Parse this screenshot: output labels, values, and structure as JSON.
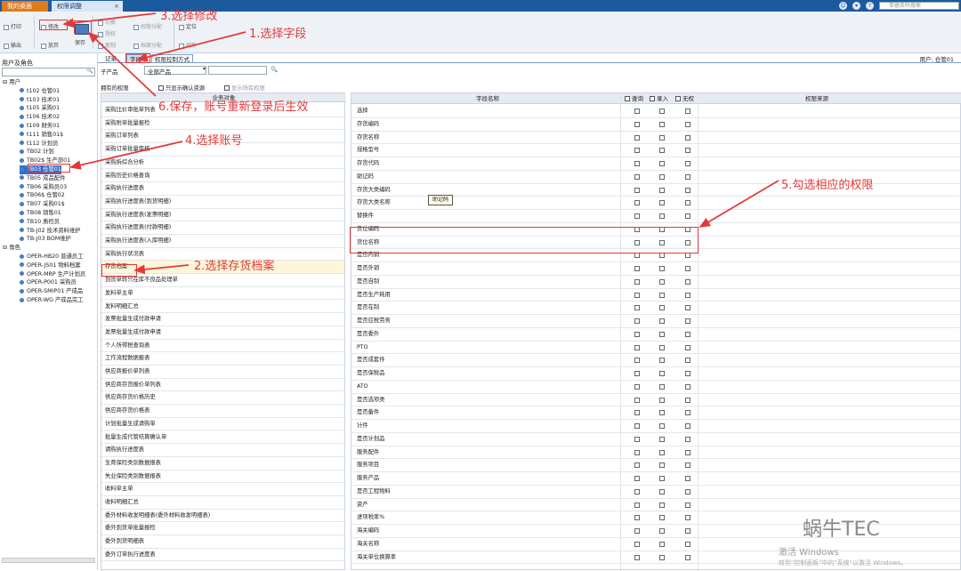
{
  "titlebar": {
    "tab_home": "我的桌面",
    "tab_permission": "权限调整",
    "tab_close": "×",
    "search_placeholder": "单据条码搜索"
  },
  "toolbar": {
    "print": "打印",
    "export": "输出",
    "modify": "修改",
    "abandon": "放弃",
    "save": "保存",
    "copy": "复制",
    "toggle": "切换",
    "authorize": "授权",
    "permission_assign": "权限分配",
    "data_assign": "档案分配",
    "locate": "定位",
    "refresh": "刷新"
  },
  "left_panel": {
    "title": "用户及角色",
    "search_btn": "🔍",
    "users_root": "用户",
    "users": [
      "t102  仓管01",
      "t103  技术01",
      "t105  采购01",
      "t106  技术02",
      "t109  财务01",
      "t111  销售01$",
      "t112  计划员",
      "TB02  计划",
      "TB02$  生产部01",
      "TB03  仓管01",
      "TB05  成品配件",
      "TB06  采购员03",
      "TB06$  仓管02",
      "TB07  采购01$",
      "TB08  销售01",
      "TB10  质检员",
      "TB-J02  技术资料维护",
      "TB-J03  BOM维护"
    ],
    "roles_root": "角色",
    "roles": [
      "OPER-HB20  普通员工",
      "OPER-JS01  物料档案",
      "OPER-MRP  生产计划员",
      "OPER-P001  采购员",
      "OPER-SMIP01  产成品",
      "OPER-WG  产成品完工"
    ]
  },
  "subtabs": {
    "record": "记录",
    "field": "字段",
    "control": "权限控制方式"
  },
  "user_label": "用户: 仓管01",
  "filter": {
    "subproduct_label": "子产品",
    "subproduct_value": "全部产品",
    "owned_label": "拥有的权限",
    "only_show_tail": "只显示确认资源",
    "show_all": "显示所有权限"
  },
  "object_list": {
    "header": "业务对象",
    "rows": [
      "采购比价审批单列表",
      "采购附单批量报检",
      "采购订单列表",
      "采购订单批量审核",
      "采购拆综合分析",
      "采购历史价格查询",
      "采购执行进度表",
      "采购执行进度表(到货明细)",
      "采购执行进度表(发票明细)",
      "采购执行进度表(付款明细)",
      "采购执行进度表(入库明细)",
      "采购执行状况表",
      "存货档案",
      "到货单转只在库不良品处理单",
      "发料单主单",
      "发料明细汇总",
      "发票批量生成付款申请",
      "发票批量生成付款申请",
      "个人所得税查询表",
      "工作流程数据报表",
      "供应商报价单列表",
      "供应商存货报价单列表",
      "供应商存货价格历史",
      "供应商存货价格表",
      "计划批量生成请购单",
      "批量生成代管结算确认单",
      "请购执行进度表",
      "生育保险类别数据报表",
      "失业保险类别数据报表",
      "收料单主单",
      "收料明细汇总",
      "委外材料收发明细表(委外材料收发明细表)",
      "委外到货单批量报检",
      "委外到货明细表",
      "委外订单执行进度表"
    ]
  },
  "field_grid": {
    "header_name": "字段名称",
    "header_query": "查询",
    "header_entry": "录入",
    "header_none": "无权",
    "header_source": "权限来源",
    "rows": [
      "选择",
      "存货编码",
      "存货名称",
      "规格型号",
      "存货代码",
      "助记码",
      "存货大类编码",
      "存货大类名称",
      "替换件",
      "货位编码",
      "货位名称",
      "是否内销",
      "是否外销",
      "是否自制",
      "是否生产耗用",
      "是否在制",
      "是否应税劳务",
      "是否委外",
      "PTO",
      "是否成套件",
      "是否保税品",
      "ATO",
      "是否选项类",
      "是否备件",
      "计件",
      "是否计划品",
      "服务配件",
      "服务项目",
      "服务产品",
      "是否工程物料",
      "资产",
      "进项税率%",
      "海关编码",
      "海关名称",
      "海关单位换算率"
    ]
  },
  "tooltip": "助记码",
  "annotations": {
    "a1": "1.选择字段",
    "a2": "2.选择存货档案",
    "a3": "3.选择修改",
    "a4": "4.选择账号",
    "a5": "5.勾选相应的权限",
    "a6": "6.保存，账号重新登录后生效"
  },
  "watermark": {
    "logo": "蜗牛TEC",
    "line1": "激活 Windows",
    "line2": "转到\"控制面板\"中的\"系统\"以激活 Windows。"
  }
}
